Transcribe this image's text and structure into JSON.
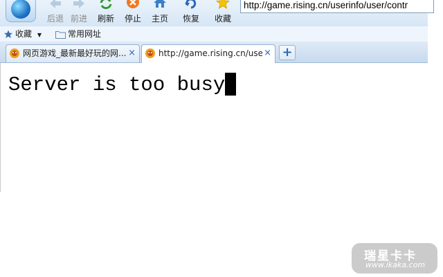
{
  "toolbar": {
    "back_label": "后退",
    "forward_label": "前进",
    "refresh_label": "刷新",
    "stop_label": "停止",
    "home_label": "主页",
    "restore_label": "恢复",
    "favorites_label": "收藏"
  },
  "address": {
    "value": "http://game.rising.cn/userinfo/user/contr"
  },
  "favbar": {
    "favorites_menu": "收藏",
    "common_sites": "常用网址"
  },
  "tabs": [
    {
      "title": "网页游戏_最新最好玩的网...",
      "close": "×"
    },
    {
      "title": "http://game.rising.cn/use...",
      "close": "×"
    }
  ],
  "newtab": {
    "symbol": "+"
  },
  "content": {
    "message": "Server is too busy"
  },
  "watermark": {
    "line1": "瑞星卡卡",
    "line2": "www.ikaka.com"
  },
  "colors": {
    "accent": "#2b67b8",
    "toolbar_bg": "#d6e6f5",
    "stop_orange": "#f07820"
  }
}
